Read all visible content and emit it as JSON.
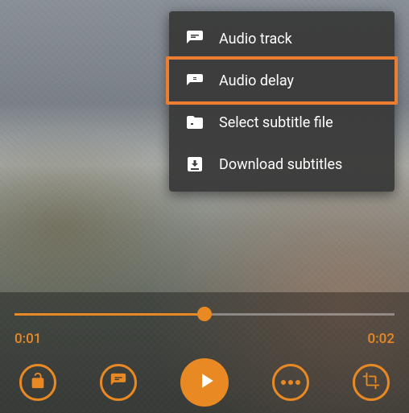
{
  "menu": {
    "items": [
      {
        "label": "Audio track",
        "icon": "speech-bubble-icon",
        "highlighted": false
      },
      {
        "label": "Audio delay",
        "icon": "delay-icon",
        "highlighted": true
      },
      {
        "label": "Select subtitle file",
        "icon": "folder-icon",
        "highlighted": false
      },
      {
        "label": "Download subtitles",
        "icon": "download-icon",
        "highlighted": false
      }
    ]
  },
  "playback": {
    "current_time": "0:01",
    "total_time": "0:02",
    "progress_percent": 50
  },
  "colors": {
    "accent": "#e88924",
    "highlight": "#ed7d31",
    "menu_bg": "#3a3a3a"
  }
}
